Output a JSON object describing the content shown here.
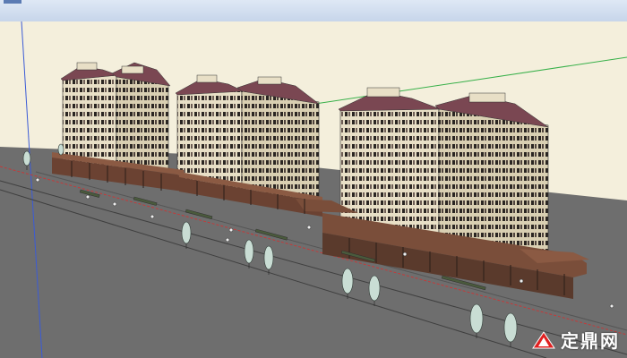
{
  "viewport": {
    "background_color": "#f4efdc",
    "ground_color": "#6e6e6e",
    "road_color": "#5e5e5e",
    "axis_blue": "#3b5bd6",
    "axis_green": "#37b049",
    "axis_red": "#c43a3a"
  },
  "model": {
    "tower_body_color": "#e8dfc6",
    "tower_shadow_color": "#cfc3a5",
    "roof_color": "#7a4752",
    "podium_color": "#8b5a43",
    "window_color": "#2a2522",
    "tree_color": "#c9ddd4"
  },
  "watermark": {
    "logo_icon": "dingding-logo-icon",
    "text": "定鼎网",
    "logo_color": "#e02020"
  }
}
